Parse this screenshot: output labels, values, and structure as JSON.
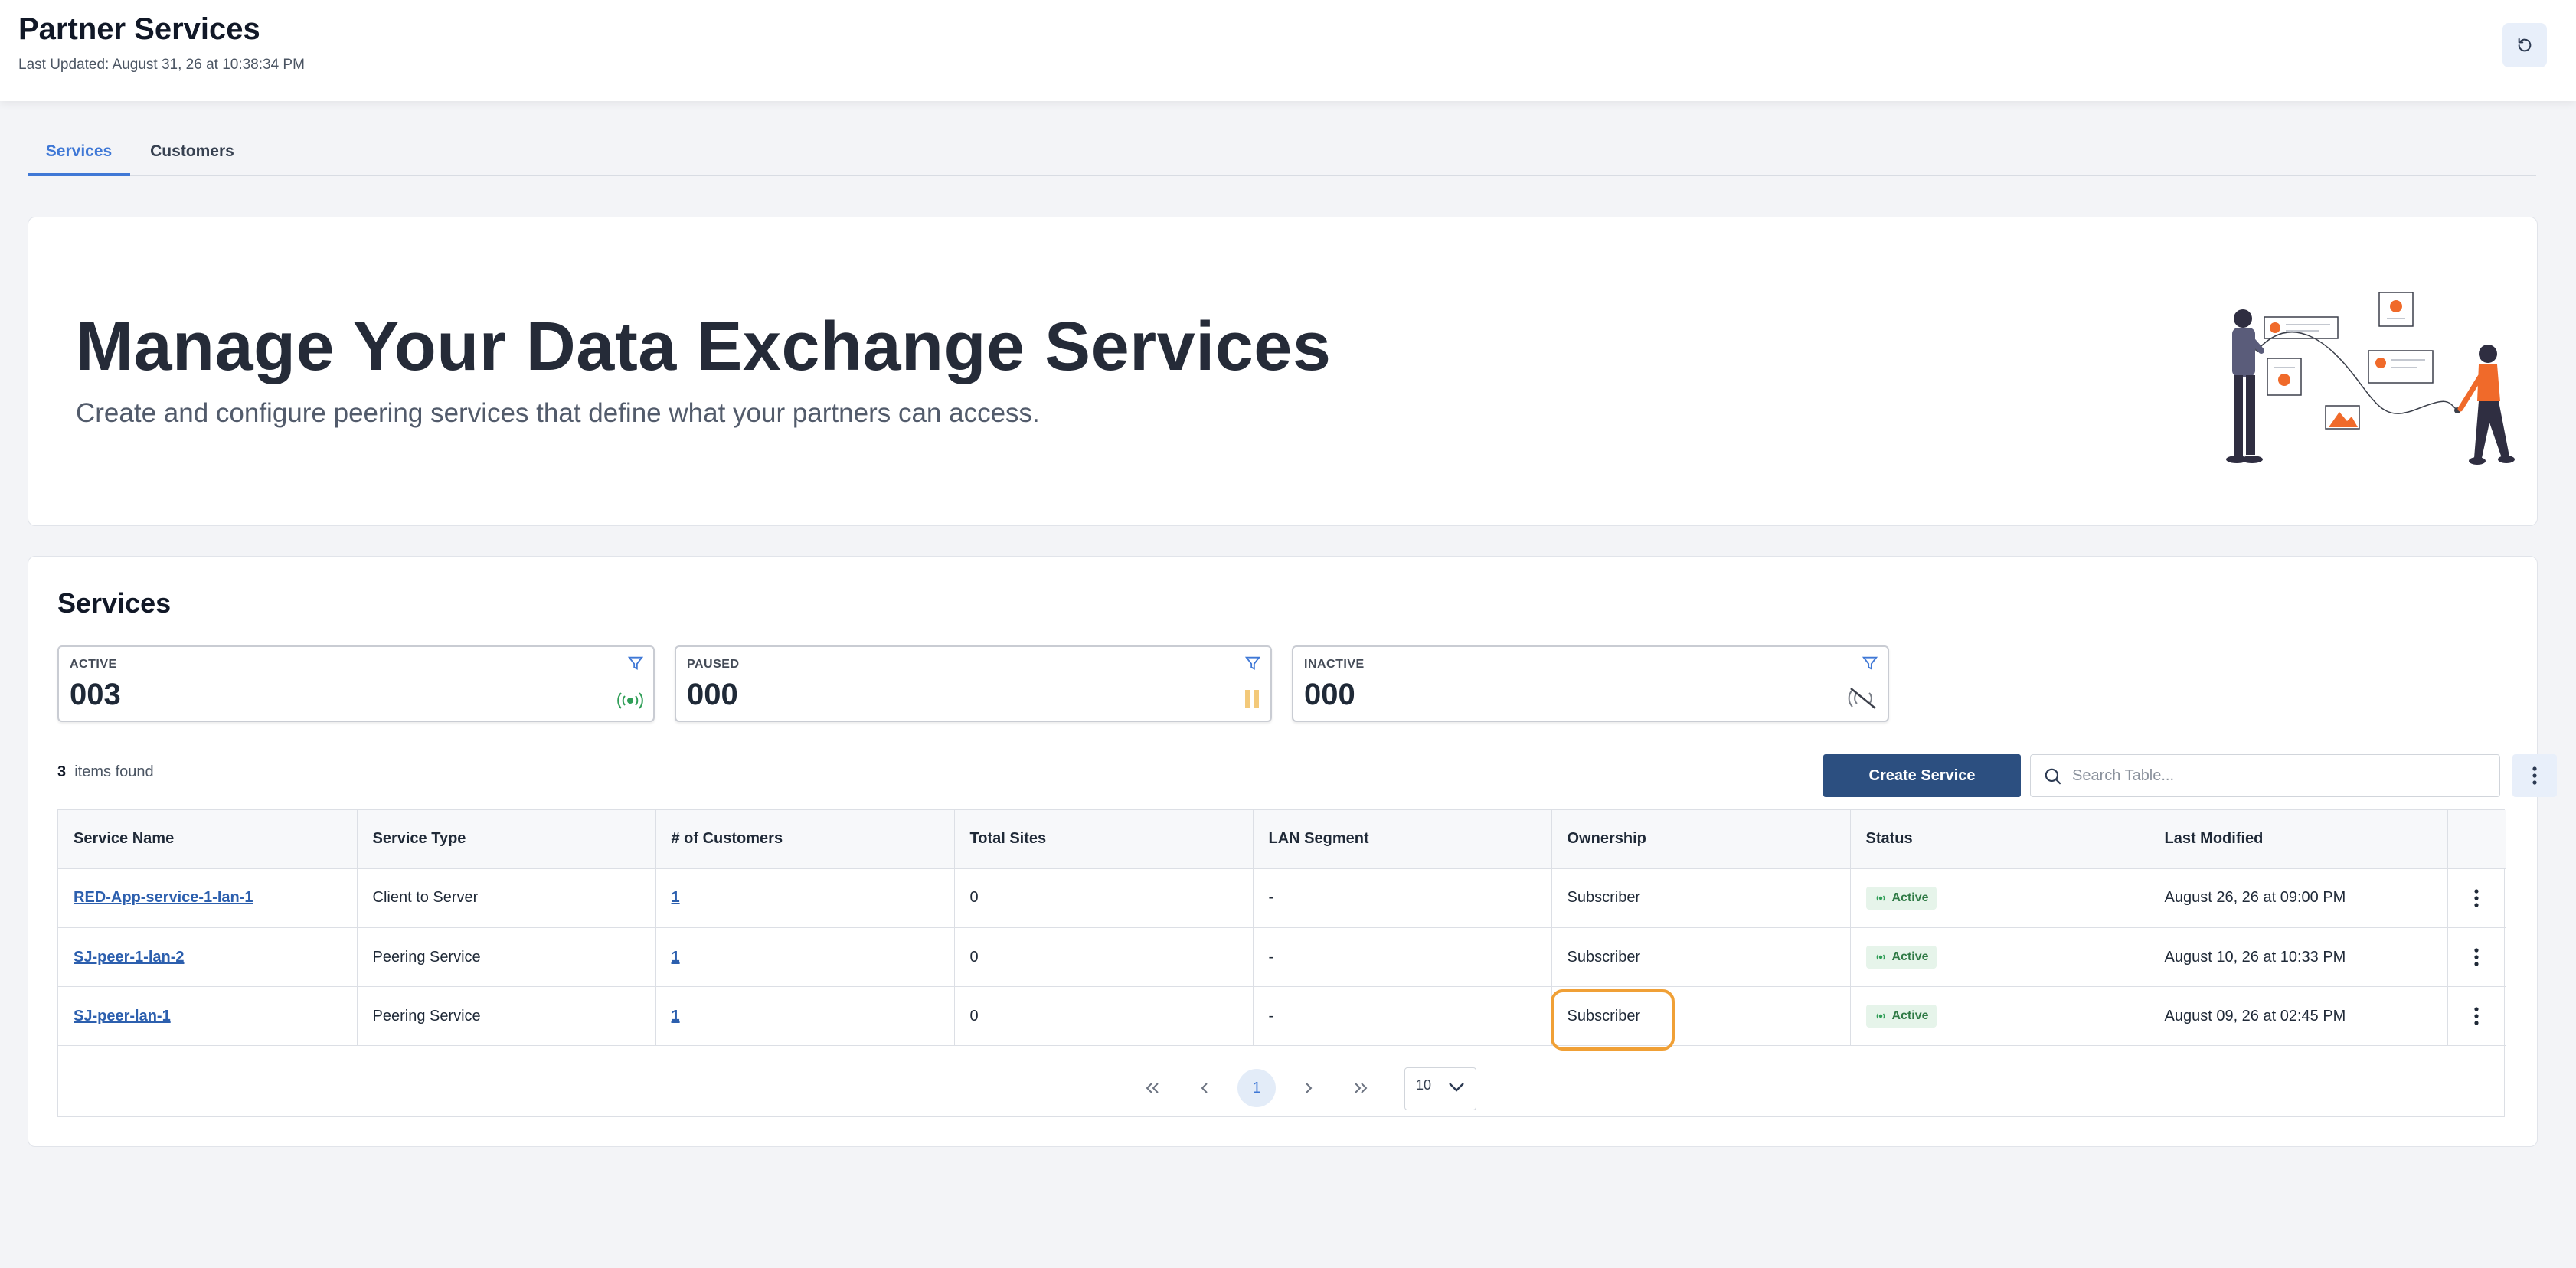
{
  "header": {
    "title": "Partner Services",
    "last_updated": "Last Updated: August 31, 26 at 10:38:34 PM"
  },
  "tabs": [
    {
      "label": "Services",
      "active": true
    },
    {
      "label": "Customers",
      "active": false
    }
  ],
  "hero": {
    "title": "Manage Your Data Exchange Services",
    "subtitle": "Create and configure peering services that define what your partners can access."
  },
  "services": {
    "title": "Services",
    "stats": [
      {
        "label": "ACTIVE",
        "value": "003",
        "icon": "signal-icon",
        "color": "#2f9e57"
      },
      {
        "label": "PAUSED",
        "value": "000",
        "icon": "pause-icon",
        "color": "#f3c97a"
      },
      {
        "label": "INACTIVE",
        "value": "000",
        "icon": "signal-off-icon",
        "color": "#7a7f88"
      }
    ],
    "items_count": "3",
    "items_label": "items found",
    "create_label": "Create Service",
    "search_placeholder": "Search Table..."
  },
  "table": {
    "columns": [
      "Service Name",
      "Service Type",
      "# of Customers",
      "Total Sites",
      "LAN Segment",
      "Ownership",
      "Status",
      "Last Modified"
    ],
    "rows": [
      {
        "name": "RED-App-service-1-lan-1",
        "type": "Client to Server",
        "customers": "1",
        "sites": "0",
        "lan": "-",
        "ownership": "Subscriber",
        "status": "Active",
        "modified": "August 26, 26 at 09:00 PM"
      },
      {
        "name": "SJ-peer-1-lan-2",
        "type": "Peering Service",
        "customers": "1",
        "sites": "0",
        "lan": "-",
        "ownership": "Subscriber",
        "status": "Active",
        "modified": "August 10, 26 at 10:33 PM"
      },
      {
        "name": "SJ-peer-lan-1",
        "type": "Peering Service",
        "customers": "1",
        "sites": "0",
        "lan": "-",
        "ownership": "Subscriber",
        "status": "Active",
        "modified": "August 09, 26 at 02:45 PM"
      }
    ]
  },
  "pagination": {
    "current_page": "1",
    "page_size": "10"
  },
  "colors": {
    "accent": "#3f78d6",
    "primary_button": "#2c4f80",
    "highlight": "#f0a036",
    "status_active": "#2f7a45"
  }
}
